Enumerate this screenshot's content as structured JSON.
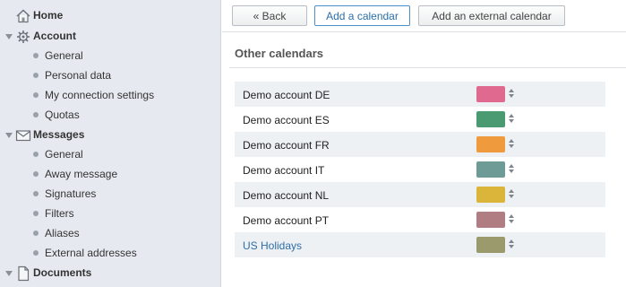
{
  "sidebar": {
    "home": {
      "label": "Home",
      "icon": "home-icon"
    },
    "account": {
      "label": "Account",
      "icon": "gear-icon",
      "items": [
        "General",
        "Personal data",
        "My connection settings",
        "Quotas"
      ]
    },
    "messages": {
      "label": "Messages",
      "icon": "envelope-icon",
      "items": [
        "General",
        "Away message",
        "Signatures",
        "Filters",
        "Aliases",
        "External addresses"
      ]
    },
    "documents": {
      "label": "Documents",
      "icon": "document-icon"
    }
  },
  "toolbar": {
    "back_label": "« Back",
    "add_calendar_label": "Add a calendar",
    "add_external_label": "Add an external calendar"
  },
  "main": {
    "heading": "Other calendars",
    "calendars": [
      {
        "name": "Demo account DE",
        "color": "#e0698f",
        "link": false
      },
      {
        "name": "Demo account ES",
        "color": "#4a9a72",
        "link": false
      },
      {
        "name": "Demo account FR",
        "color": "#ef9a3d",
        "link": false
      },
      {
        "name": "Demo account IT",
        "color": "#6f9b97",
        "link": false
      },
      {
        "name": "Demo account NL",
        "color": "#dbb43a",
        "link": false
      },
      {
        "name": "Demo account PT",
        "color": "#b07d82",
        "link": false
      },
      {
        "name": "US Holidays",
        "color": "#9a9a6c",
        "link": true
      }
    ]
  }
}
